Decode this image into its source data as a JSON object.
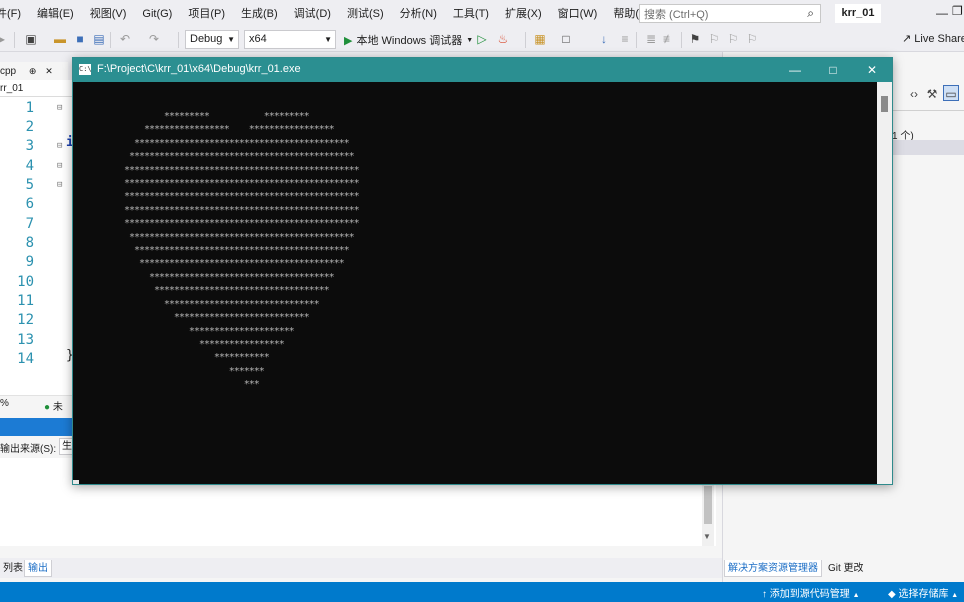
{
  "menu": {
    "items": [
      "件(F)",
      "编辑(E)",
      "视图(V)",
      "Git(G)",
      "项目(P)",
      "生成(B)",
      "调试(D)",
      "测试(S)",
      "分析(N)",
      "工具(T)",
      "扩展(X)",
      "窗口(W)",
      "帮助(H)"
    ],
    "search_placeholder": "搜索 (Ctrl+Q)",
    "solution_name": "krr_01"
  },
  "toolbar": {
    "config": "Debug",
    "platform": "x64",
    "run_label": "本地 Windows 调试器",
    "live_share": "Live Share"
  },
  "editor": {
    "tab_label": "cpp",
    "nav_combo": "rr_01",
    "line_numbers": [
      "1",
      "2",
      "3",
      "4",
      "5",
      "6",
      "7",
      "8",
      "9",
      "10",
      "11",
      "12",
      "13",
      "14"
    ],
    "zoom": "%",
    "status_text": "未"
  },
  "output": {
    "source_label": "输出来源(S):",
    "source_value": "生"
  },
  "bottom_tabs": [
    "列表",
    "输出"
  ],
  "right_panel": {
    "count_text": "1 个)",
    "tabs": [
      "解决方案资源管理器",
      "Git 更改"
    ]
  },
  "status_bar": {
    "add_source": "添加到源代码管理",
    "select_repo": "选择存储库"
  },
  "console": {
    "title": "F:\\Project\\C\\krr_01\\x64\\Debug\\krr_01.exe",
    "icon_text": "C:\\",
    "output": "        *********           *********\n    *****************    *****************\n  *******************************************\n *********************************************\n***********************************************\n***********************************************\n***********************************************\n***********************************************\n***********************************************\n *********************************************\n  *******************************************\n   *****************************************\n     *************************************\n      ***********************************\n        *******************************\n          ***************************\n             *********************\n               *****************\n                  ***********\n                     *******\n                        ***"
  }
}
